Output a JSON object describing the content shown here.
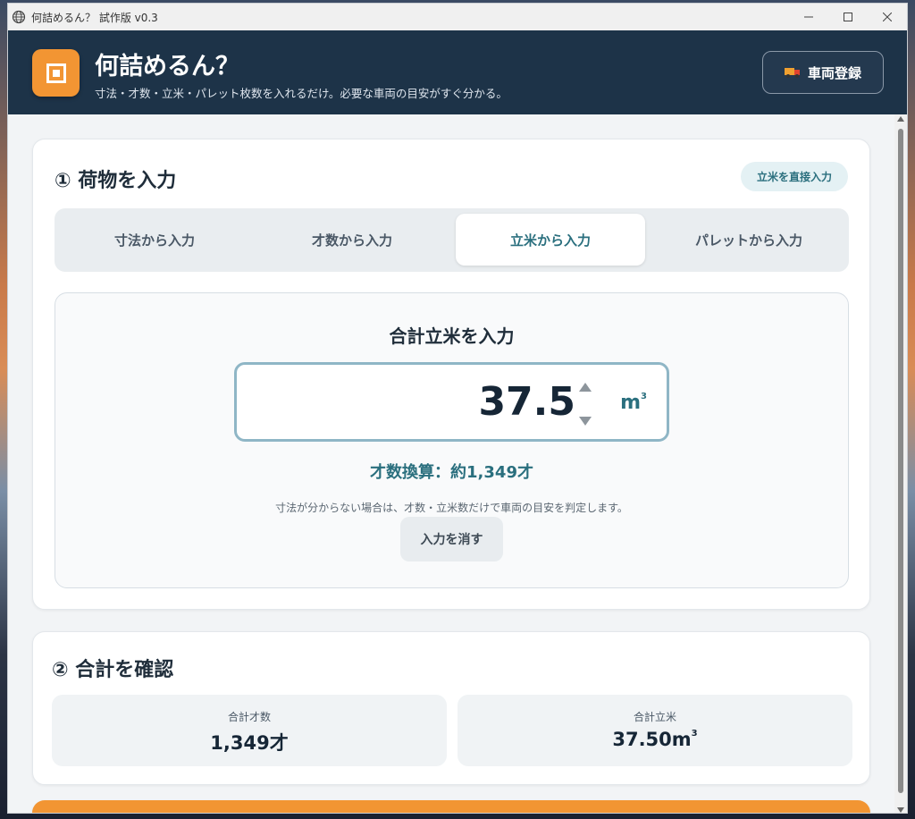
{
  "window": {
    "title": "何詰めるん？ 試作版 v0.3"
  },
  "header": {
    "title": "何詰めるん？",
    "subtitle": "寸法・才数・立米・パレット枚数を入れるだけ。必要な車両の目安がすぐ分かる。",
    "register_button": "車両登録"
  },
  "section1": {
    "title": "① 荷物を入力",
    "direct_button": "立米を直接入力",
    "tabs": [
      {
        "label": "寸法から入力",
        "active": false
      },
      {
        "label": "才数から入力",
        "active": false
      },
      {
        "label": "立米から入力",
        "active": true
      },
      {
        "label": "パレットから入力",
        "active": false
      }
    ],
    "panel": {
      "title": "合計立米を入力",
      "value": "37.5",
      "unit": "m",
      "unit_sup": "3",
      "conversion": "才数換算：約1,349才",
      "note": "寸法が分からない場合は、才数・立米数だけで車両の目安を判定します。",
      "clear_button": "入力を消す"
    }
  },
  "section2": {
    "title": "② 合計を確認",
    "total_sai_label": "合計才数",
    "total_sai_value": "1,349才",
    "total_m3_label": "合計立米",
    "total_m3_value": "37.50m",
    "total_m3_sup": "3"
  },
  "colors": {
    "header_bg": "#1d3348",
    "accent_orange": "#f29533",
    "accent_teal": "#2a6f7e"
  }
}
